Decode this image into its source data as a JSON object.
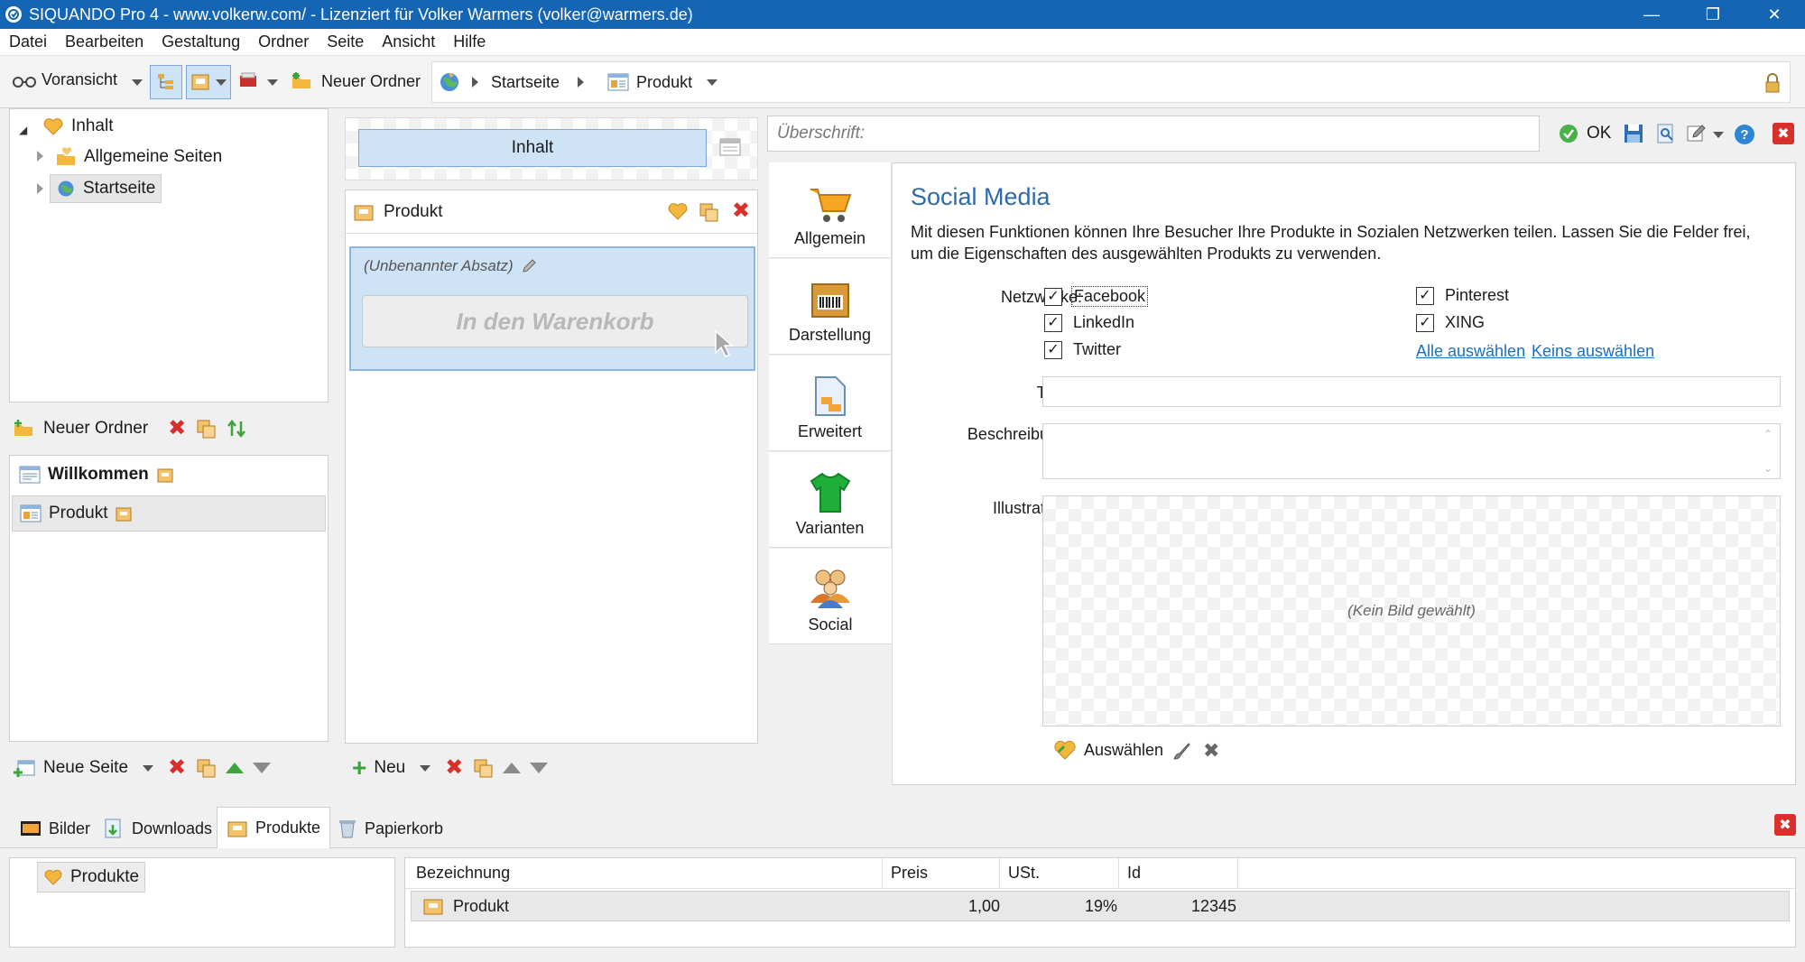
{
  "window": {
    "title": "SIQUANDO Pro 4 - www.volkerw.com/ - Lizenziert für Volker Warmers (volker@warmers.de)"
  },
  "menu": [
    "Datei",
    "Bearbeiten",
    "Gestaltung",
    "Ordner",
    "Seite",
    "Ansicht",
    "Hilfe"
  ],
  "toolbar": {
    "preview_label": "Voransicht",
    "new_folder_label": "Neuer Ordner",
    "breadcrumb": [
      "Startseite",
      "Produkt"
    ]
  },
  "tree": {
    "root": "Inhalt",
    "items": [
      "Allgemeine Seiten",
      "Startseite"
    ]
  },
  "folder_toolbar": {
    "new_folder_label": "Neuer Ordner"
  },
  "pages": {
    "items": [
      "Willkommen",
      "Produkt"
    ]
  },
  "pages_toolbar": {
    "new_page_label": "Neue Seite"
  },
  "middle": {
    "content_button": "Inhalt",
    "product_header": "Produkt",
    "paragraph_label": "(Unbenannter Absatz)",
    "cart_button": "In den Warenkorb",
    "new_label": "Neu"
  },
  "editor": {
    "heading_placeholder": "Überschrift:",
    "ok_label": "OK",
    "tabs": [
      "Allgemein",
      "Darstellung",
      "Erweitert",
      "Varianten",
      "Social"
    ],
    "section_title": "Social Media",
    "description": "Mit diesen Funktionen können Ihre Besucher Ihre Produkte in Sozialen Netzwerken teilen. Lassen Sie die Felder frei, um die Eigenschaften des ausgewählten Produkts zu verwenden.",
    "networks_label": "Netzwerke:",
    "networks_left": [
      "Facebook",
      "LinkedIn",
      "Twitter"
    ],
    "networks_right": [
      "Pinterest",
      "XING"
    ],
    "select_all": "Alle auswählen",
    "select_none": "Keins auswählen",
    "title_label": "Titel:",
    "description_label": "Beschreibung:",
    "illustration_label": "Illustration:",
    "no_image": "(Kein Bild gewählt)",
    "choose_label": "Auswählen"
  },
  "bottom_tabs": [
    "Bilder",
    "Downloads",
    "Produkte",
    "Papierkorb"
  ],
  "bottom": {
    "folder": "Produkte",
    "columns": [
      "Bezeichnung",
      "Preis",
      "USt.",
      "Id"
    ],
    "rows": [
      {
        "name": "Produkt",
        "price": "1,00",
        "vat": "19%",
        "id": "12345"
      }
    ]
  }
}
